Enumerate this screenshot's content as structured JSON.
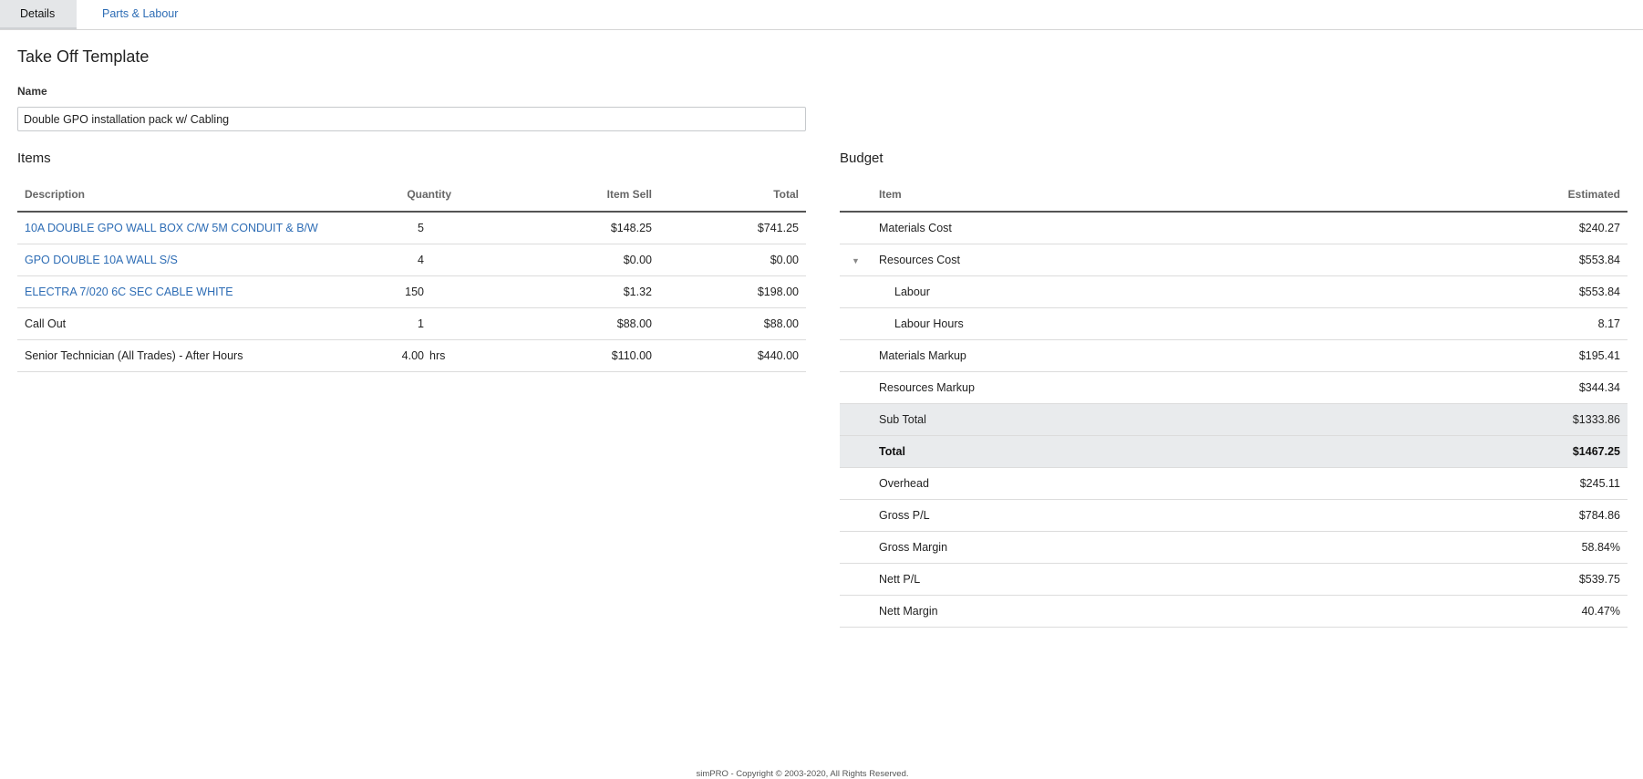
{
  "tabs": [
    {
      "label": "Details"
    },
    {
      "label": "Parts & Labour"
    }
  ],
  "page": {
    "title": "Take Off Template",
    "name_label": "Name",
    "name_value": "Double GPO installation pack w/ Cabling"
  },
  "items": {
    "title": "Items",
    "headers": {
      "description": "Description",
      "quantity": "Quantity",
      "item_sell": "Item Sell",
      "total": "Total"
    },
    "rows": [
      {
        "description": "10A DOUBLE GPO WALL BOX C/W 5M CONDUIT & B/W",
        "quantity": "5",
        "unit": "",
        "item_sell": "$148.25",
        "total": "$741.25"
      },
      {
        "description": "GPO DOUBLE 10A WALL S/S",
        "quantity": "4",
        "unit": "",
        "item_sell": "$0.00",
        "total": "$0.00"
      },
      {
        "description": "ELECTRA 7/020 6C SEC CABLE WHITE",
        "quantity": "150",
        "unit": "",
        "item_sell": "$1.32",
        "total": "$198.00"
      },
      {
        "description": "Call Out",
        "quantity": "1",
        "unit": "",
        "item_sell": "$88.00",
        "total": "$88.00"
      },
      {
        "description": "Senior Technician (All Trades) - After Hours",
        "quantity": "4.00",
        "unit": "hrs",
        "item_sell": "$110.00",
        "total": "$440.00"
      }
    ]
  },
  "budget": {
    "title": "Budget",
    "headers": {
      "item": "Item",
      "estimated": "Estimated"
    },
    "rows": [
      {
        "item": "Materials Cost",
        "estimated": "$240.27"
      },
      {
        "item": "Resources Cost",
        "estimated": "$553.84"
      },
      {
        "item": "Labour",
        "estimated": "$553.84"
      },
      {
        "item": "Labour Hours",
        "estimated": "8.17"
      },
      {
        "item": "Materials Markup",
        "estimated": "$195.41"
      },
      {
        "item": "Resources Markup",
        "estimated": "$344.34"
      },
      {
        "item": "Sub Total",
        "estimated": "$1333.86"
      },
      {
        "item": "Total",
        "estimated": "$1467.25"
      },
      {
        "item": "Overhead",
        "estimated": "$245.11"
      },
      {
        "item": "Gross P/L",
        "estimated": "$784.86"
      },
      {
        "item": "Gross Margin",
        "estimated": "58.84%"
      },
      {
        "item": "Nett P/L",
        "estimated": "$539.75"
      },
      {
        "item": "Nett Margin",
        "estimated": "40.47%"
      }
    ]
  },
  "footer": {
    "text": "simPRO - Copyright © 2003-2020, All Rights Reserved."
  },
  "colors": {
    "link": "#2e6db5",
    "tab_active_bg": "#e4e6e8",
    "shaded_row_bg": "#e9ebed"
  },
  "icons": {
    "collapse_caret": "caret-down-icon"
  }
}
